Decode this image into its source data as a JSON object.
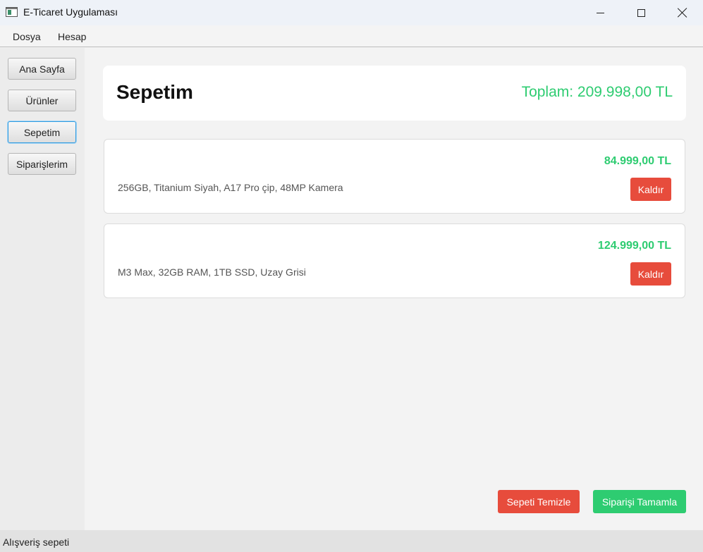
{
  "window": {
    "title": "E-Ticaret Uygulaması",
    "icon": "app-window-icon",
    "controls": [
      "minimize-icon",
      "maximize-icon",
      "close-icon"
    ]
  },
  "menu": {
    "items": [
      {
        "label": "Dosya"
      },
      {
        "label": "Hesap"
      }
    ]
  },
  "sidebar": {
    "items": [
      {
        "label": "Ana Sayfa",
        "active": false
      },
      {
        "label": "Ürünler",
        "active": false
      },
      {
        "label": "Sepetim",
        "active": true
      },
      {
        "label": "Siparişlerim",
        "active": false
      }
    ]
  },
  "cart": {
    "title": "Sepetim",
    "total": "Toplam: 209.998,00 TL",
    "items": [
      {
        "price": "84.999,00 TL",
        "description": "256GB, Titanium Siyah, A17 Pro çip, 48MP Kamera",
        "remove_label": "Kaldır"
      },
      {
        "price": "124.999,00 TL",
        "description": "M3 Max, 32GB RAM, 1TB SSD, Uzay Grisi",
        "remove_label": "Kaldır"
      }
    ],
    "clear_label": "Sepeti Temizle",
    "checkout_label": "Siparişi Tamamla"
  },
  "status": {
    "text": "Alışveriş sepeti"
  },
  "colors": {
    "accent_green": "#2ecc71",
    "danger_red": "#e74c3c",
    "focus_blue": "#2f9be0"
  }
}
